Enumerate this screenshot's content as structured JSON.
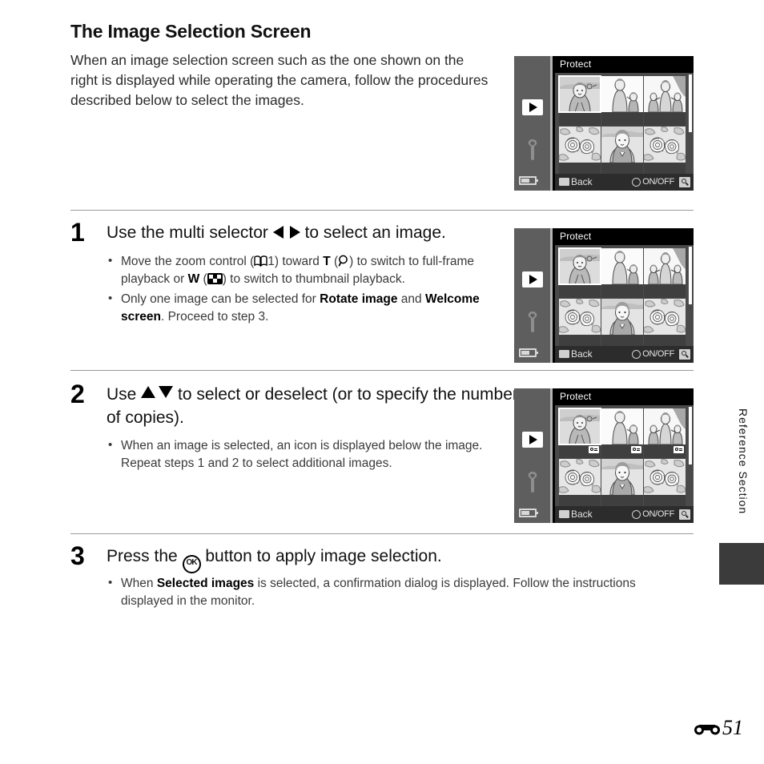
{
  "page": {
    "heading": "The Image Selection Screen",
    "intro": "When an image selection screen such as the one shown on the right is displayed while operating the camera, follow the procedures described below to select the images.",
    "side_label": "Reference Section",
    "page_number": "51",
    "page_prefix_icon": "reference-section-glyph"
  },
  "steps": [
    {
      "number": "1",
      "title_a": "Use the multi selector ",
      "title_icon": "multi-selector-left-right-icon",
      "title_b": " to select an image.",
      "bullets": [
        {
          "p1": "Move the zoom control (",
          "icon1": "book-icon",
          "p2": "1) toward ",
          "bold1": "T",
          "p3": " (",
          "icon2": "magnifier-icon",
          "p4": ") to switch to full-frame playback or ",
          "bold2": "W",
          "p5": " (",
          "icon3": "thumbnail-grid-icon",
          "p6": ") to switch to thumbnail playback."
        },
        {
          "p1": "Only one image can be selected for ",
          "bold1": "Rotate image",
          "p2": " and ",
          "bold2": "Welcome screen",
          "p3": ". Proceed to step 3."
        }
      ]
    },
    {
      "number": "2",
      "title_a": "Use ",
      "title_icon": "multi-selector-up-down-icon",
      "title_b": " to select or deselect (or to specify the number of copies).",
      "bullets": [
        {
          "p1": "When an image is selected, an icon is displayed below the image. Repeat steps 1 and 2 to select additional images."
        }
      ]
    },
    {
      "number": "3",
      "title_a": "Press the ",
      "title_icon": "ok-button-icon",
      "title_icon_label": "OK",
      "title_b": " button to apply image selection.",
      "bullets": [
        {
          "p1": "When ",
          "bold1": "Selected images",
          "p2": " is selected, a confirmation dialog is displayed. Follow the instructions displayed in the monitor."
        }
      ]
    }
  ],
  "camera_screens": [
    {
      "id": "screen-intro",
      "title": "Protect",
      "back_label": "Back",
      "onoff_label": "ON/OFF",
      "sidebar_icons": [
        "playback-tab-icon",
        "setup-wrench-icon",
        "battery-icon"
      ],
      "bottom_icons": [
        "menu-button-icon",
        "multi-selector-icon",
        "magnifier-icon"
      ],
      "thumbnails": [
        {
          "subject": "portrait-person",
          "selected": true,
          "badge": false
        },
        {
          "subject": "woman-with-child",
          "selected": false,
          "badge": false
        },
        {
          "subject": "family-group",
          "selected": false,
          "badge": false
        },
        {
          "subject": "flowers",
          "selected": false,
          "badge": false
        },
        {
          "subject": "portrait-woman",
          "selected": false,
          "badge": false
        },
        {
          "subject": "flowers",
          "selected": false,
          "badge": false
        }
      ]
    },
    {
      "id": "screen-step1",
      "title": "Protect",
      "back_label": "Back",
      "onoff_label": "ON/OFF",
      "sidebar_icons": [
        "playback-tab-icon",
        "setup-wrench-icon",
        "battery-icon"
      ],
      "bottom_icons": [
        "menu-button-icon",
        "multi-selector-icon",
        "magnifier-icon"
      ],
      "thumbnails": [
        {
          "subject": "portrait-person",
          "selected": true,
          "badge": false
        },
        {
          "subject": "woman-with-child",
          "selected": false,
          "badge": false
        },
        {
          "subject": "family-group",
          "selected": false,
          "badge": false
        },
        {
          "subject": "flowers",
          "selected": false,
          "badge": false
        },
        {
          "subject": "portrait-woman",
          "selected": false,
          "badge": false
        },
        {
          "subject": "flowers",
          "selected": false,
          "badge": false
        }
      ]
    },
    {
      "id": "screen-step2",
      "title": "Protect",
      "back_label": "Back",
      "onoff_label": "ON/OFF",
      "sidebar_icons": [
        "playback-tab-icon",
        "setup-wrench-icon",
        "battery-icon"
      ],
      "bottom_icons": [
        "menu-button-icon",
        "multi-selector-icon",
        "magnifier-icon"
      ],
      "thumbnails": [
        {
          "subject": "portrait-person",
          "selected": true,
          "badge": true
        },
        {
          "subject": "woman-with-child",
          "selected": false,
          "badge": true
        },
        {
          "subject": "family-group",
          "selected": false,
          "badge": true
        },
        {
          "subject": "flowers",
          "selected": false,
          "badge": false
        },
        {
          "subject": "portrait-woman",
          "selected": false,
          "badge": false
        },
        {
          "subject": "flowers",
          "selected": false,
          "badge": false
        }
      ]
    }
  ]
}
